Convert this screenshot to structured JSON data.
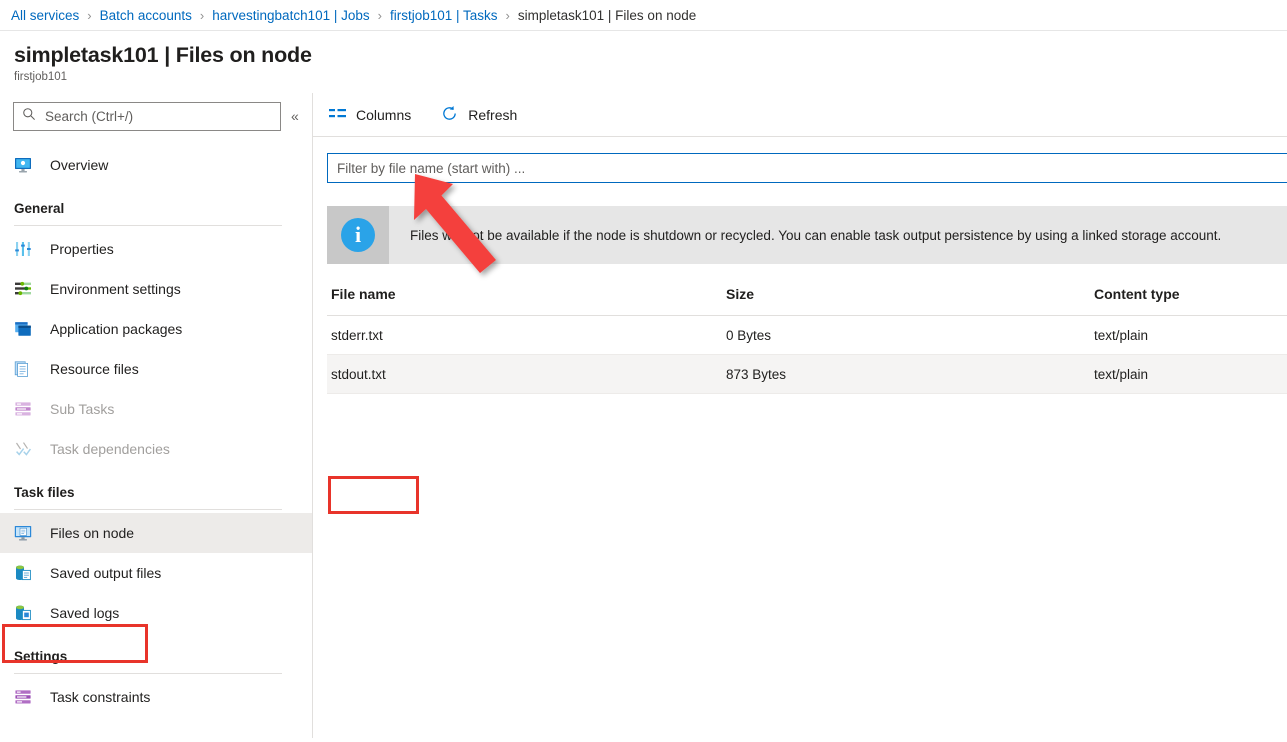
{
  "breadcrumb": {
    "separator": "›",
    "items": [
      {
        "label": "All services",
        "current": false
      },
      {
        "label": "Batch accounts",
        "current": false
      },
      {
        "label": "harvestingbatch101 | Jobs",
        "current": false
      },
      {
        "label": "firstjob101 | Tasks",
        "current": false
      },
      {
        "label": "simpletask101 | Files on node",
        "current": true
      }
    ]
  },
  "header": {
    "title": "simpletask101 | Files on node",
    "subtitle": "firstjob101"
  },
  "sidebar": {
    "search": {
      "placeholder": "Search (Ctrl+/)",
      "value": "",
      "icon": "search-icon"
    },
    "collapse_glyph": "«",
    "top_items": [
      {
        "label": "Overview",
        "icon": "overview-monitor-icon",
        "state": "normal"
      }
    ],
    "groups": [
      {
        "title": "General",
        "items": [
          {
            "label": "Properties",
            "icon": "sliders-icon",
            "state": "normal"
          },
          {
            "label": "Environment settings",
            "icon": "environment-settings-icon",
            "state": "normal"
          },
          {
            "label": "Application packages",
            "icon": "application-packages-icon",
            "state": "normal"
          },
          {
            "label": "Resource files",
            "icon": "resource-files-icon",
            "state": "normal"
          },
          {
            "label": "Sub Tasks",
            "icon": "sub-tasks-icon",
            "state": "disabled"
          },
          {
            "label": "Task dependencies",
            "icon": "task-dependencies-icon",
            "state": "disabled"
          }
        ]
      },
      {
        "title": "Task files",
        "items": [
          {
            "label": "Files on node",
            "icon": "files-on-node-icon",
            "state": "selected"
          },
          {
            "label": "Saved output files",
            "icon": "saved-output-files-icon",
            "state": "normal"
          },
          {
            "label": "Saved logs",
            "icon": "saved-logs-icon",
            "state": "normal"
          }
        ]
      },
      {
        "title": "Settings",
        "items": [
          {
            "label": "Task constraints",
            "icon": "task-constraints-icon",
            "state": "normal"
          }
        ]
      }
    ]
  },
  "command_bar": {
    "columns_label": "Columns",
    "columns_icon": "columns-icon",
    "refresh_label": "Refresh",
    "refresh_icon": "refresh-icon"
  },
  "filter": {
    "placeholder": "Filter by file name (start with) ...",
    "value": ""
  },
  "info_banner": {
    "icon": "info-icon",
    "glyph": "i",
    "text": "Files will not be available if the node is shutdown or recycled. You can enable task output persistence by using a linked storage account."
  },
  "table": {
    "columns": [
      "File name",
      "Size",
      "Content type"
    ],
    "rows": [
      {
        "file_name": "stderr.txt",
        "size": "0 Bytes",
        "content_type": "text/plain",
        "hovered": false
      },
      {
        "file_name": "stdout.txt",
        "size": "873 Bytes",
        "content_type": "text/plain",
        "hovered": true
      }
    ]
  },
  "annotations": {
    "highlight_color": "#e8342a",
    "arrow_color": "#f4413c",
    "sidebar_highlight_target": "Files on node",
    "cell_highlight_target": "stdout.txt",
    "arrow_points_to": "stdout.txt"
  }
}
